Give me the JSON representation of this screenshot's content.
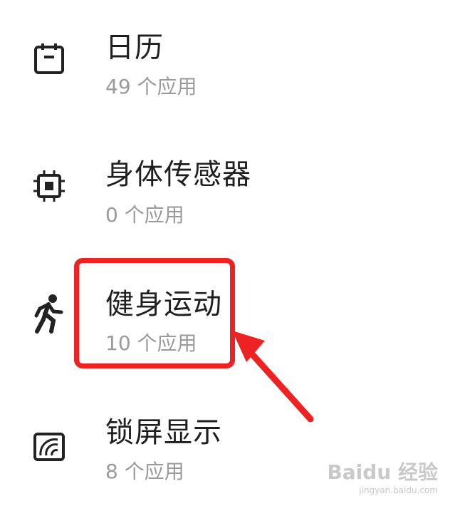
{
  "items": [
    {
      "title": "日历",
      "subtitle": "49 个应用",
      "icon": "calendar-icon"
    },
    {
      "title": "身体传感器",
      "subtitle": "0 个应用",
      "icon": "chip-icon"
    },
    {
      "title": "健身运动",
      "subtitle": "10 个应用",
      "icon": "running-icon"
    },
    {
      "title": "锁屏显示",
      "subtitle": "8 个应用",
      "icon": "lockscreen-icon"
    }
  ],
  "watermark": {
    "logo": "Baidu 经验",
    "url": "jingyan.baidu.com"
  },
  "colors": {
    "highlight": "#ee2222",
    "title": "#1f1f1f",
    "subtitle": "#9a9a9a"
  }
}
